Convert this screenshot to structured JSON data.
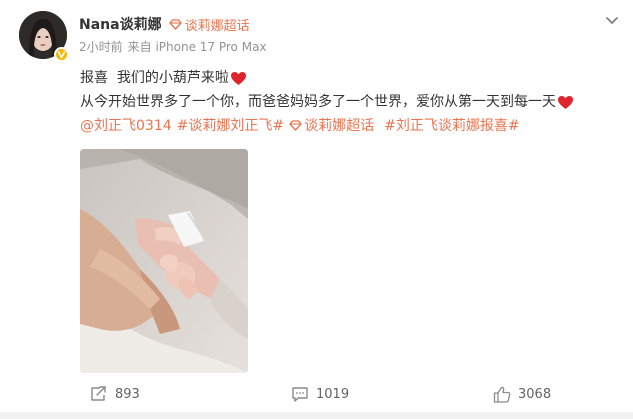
{
  "post": {
    "username": "Nana谈莉娜",
    "supertopic_label": "谈莉娜超话",
    "time": "2小时前",
    "source": "来自 iPhone 17 Pro Max",
    "line1": "报喜  我们的小葫芦来啦",
    "line2": "从今开始世界多了一个你，而爸爸妈妈多了一个世界，爱你从第一天到每一天",
    "tags": {
      "tag1": "@刘正飞0314",
      "tag2": "#谈莉娜刘正飞#",
      "tag3": "谈莉娜超话",
      "tag4": "#刘正飞谈莉娜报喜#"
    }
  },
  "actions": {
    "repost_count": "893",
    "comment_count": "1019",
    "like_count": "3068"
  },
  "icons": {
    "more": "chevron-down-icon",
    "verified": "verified-badge-icon",
    "supertopic": "diamond-icon",
    "heart": "red-heart-icon",
    "repost": "repost-icon",
    "comment": "comment-icon",
    "like": "thumbs-up-icon"
  },
  "colors": {
    "accent": "#eb7350",
    "meta_gray": "#939393",
    "heart_red": "#e0242b",
    "verified_gold": "#f5b800"
  }
}
